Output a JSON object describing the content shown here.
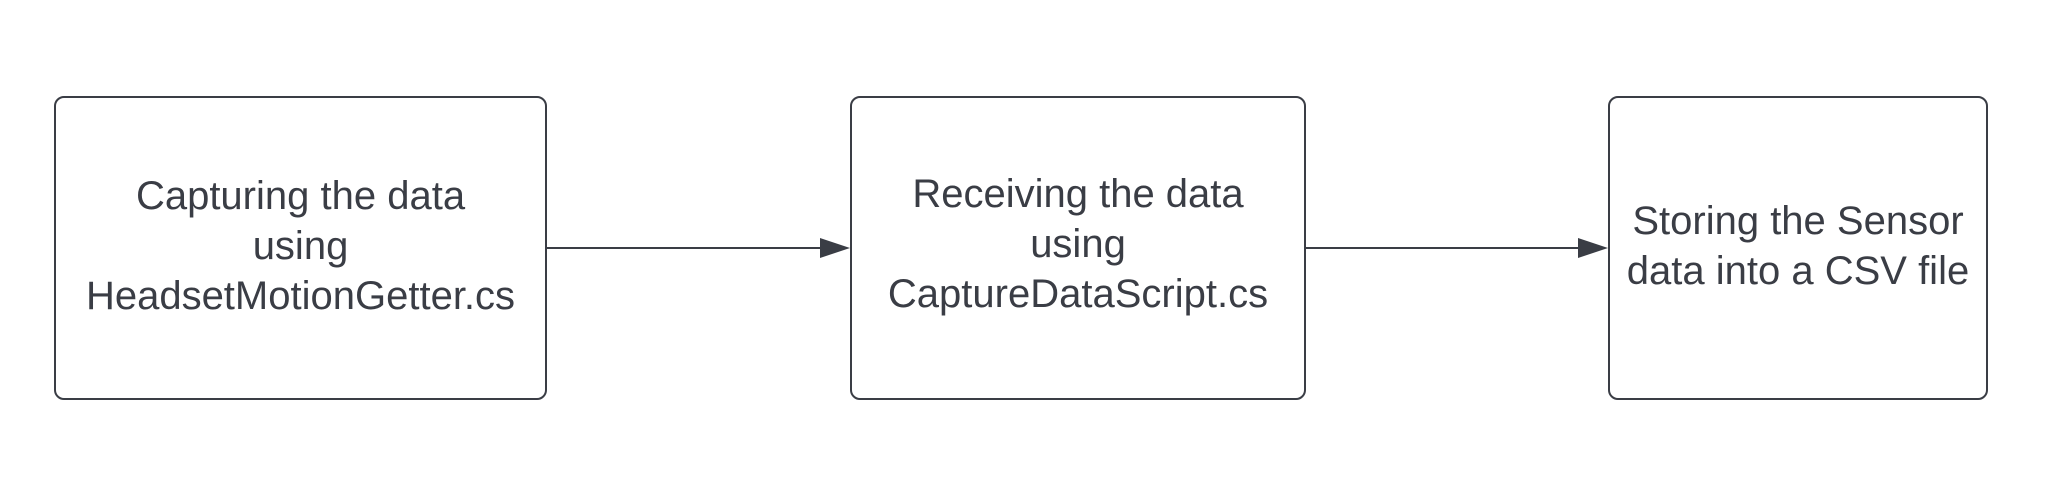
{
  "nodes": [
    {
      "id": "capture",
      "lines": [
        "Capturing the data",
        "using",
        "HeadsetMotionGetter.cs"
      ]
    },
    {
      "id": "receive",
      "lines": [
        "Receiving the data",
        "using",
        "CaptureDataScript.cs"
      ]
    },
    {
      "id": "store",
      "lines": [
        "Storing the Sensor",
        "data into a CSV file"
      ]
    }
  ],
  "edges": [
    {
      "from": "capture",
      "to": "receive"
    },
    {
      "from": "receive",
      "to": "store"
    }
  ],
  "colors": {
    "stroke": "#3a3d45",
    "text": "#3a3d45",
    "background": "#ffffff"
  }
}
